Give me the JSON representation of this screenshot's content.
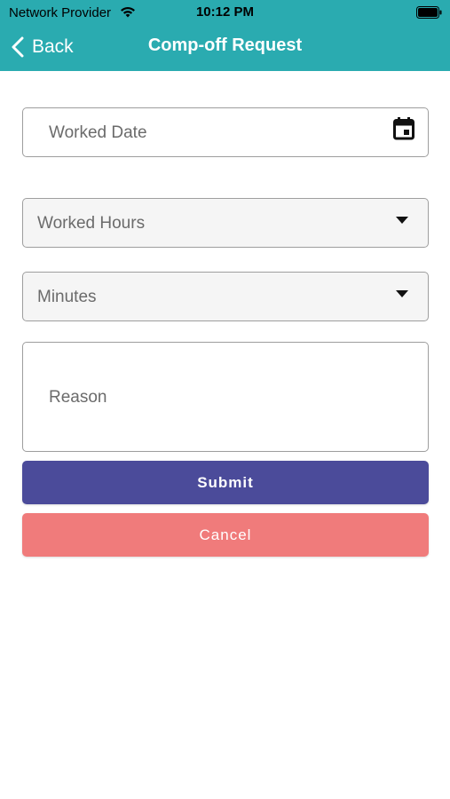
{
  "status_bar": {
    "carrier": "Network Provider",
    "time": "10:12 PM"
  },
  "nav": {
    "back_label": "Back",
    "title": "Comp-off Request"
  },
  "form": {
    "worked_date_placeholder": "Worked Date",
    "worked_hours_placeholder": "Worked Hours",
    "minutes_placeholder": "Minutes",
    "reason_placeholder": "Reason"
  },
  "buttons": {
    "submit_label": "Submit",
    "cancel_label": "Cancel"
  },
  "colors": {
    "header": "#2aabb0",
    "submit": "#4b4b9a",
    "cancel": "#f07b7b"
  },
  "icons": {
    "back": "chevron-left-icon",
    "wifi": "wifi-icon",
    "battery": "battery-icon",
    "calendar": "calendar-icon",
    "dropdown": "dropdown-icon"
  }
}
